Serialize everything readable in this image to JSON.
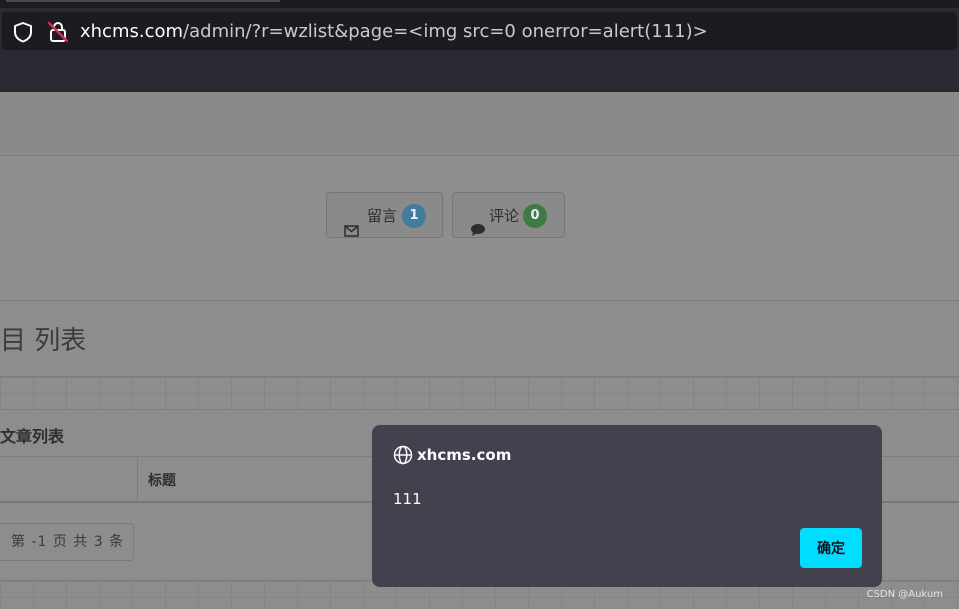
{
  "browser": {
    "url_host": "xhcms.com",
    "url_path": "/admin/?r=wzlist&page=<img src=0 onerror=alert(111)>",
    "icons": {
      "shield": "shield-icon",
      "lock": "insecure-lock-icon"
    }
  },
  "page": {
    "buttons": [
      {
        "icon": "envelope-icon",
        "label": "留言",
        "count": "1",
        "badge_color": "#3f7d9a"
      },
      {
        "icon": "comments-icon",
        "label": "评论",
        "count": "0",
        "badge_color": "#3f7a42"
      }
    ],
    "heading": "目 列表",
    "section_title": "文章列表",
    "table": {
      "columns": [
        "",
        "标题"
      ]
    },
    "pagination": "第 -1 页 共 3 条"
  },
  "alert": {
    "origin": "xhcms.com",
    "message": "111",
    "ok_label": "确定",
    "ok_color": "#00ddff"
  },
  "watermark": "CSDN @Aukum"
}
